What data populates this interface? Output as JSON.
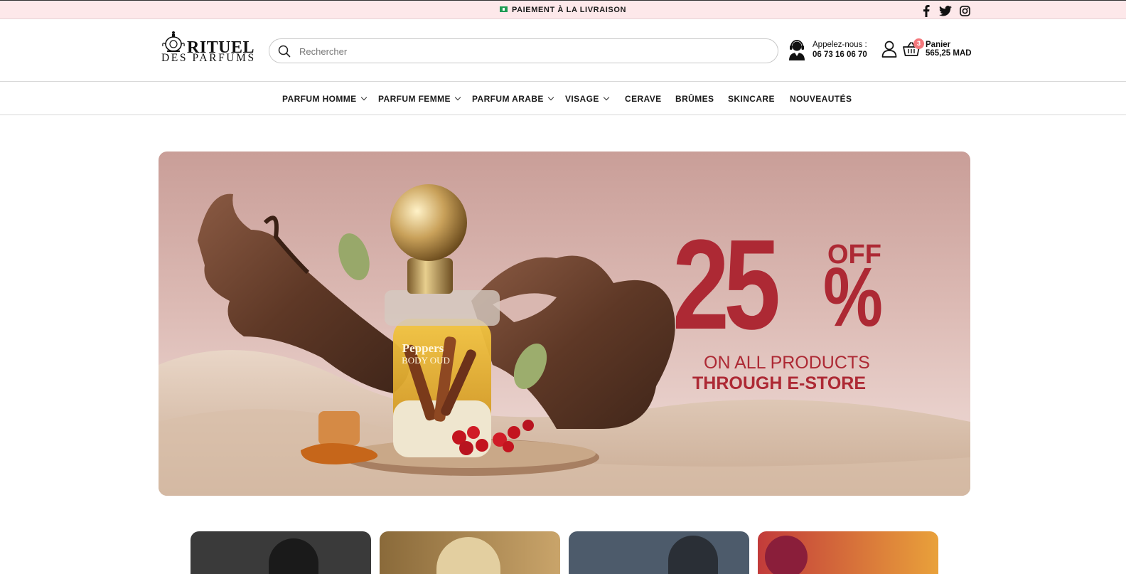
{
  "topbar": {
    "announcement": "PAIEMENT À LA LIVRAISON",
    "social": [
      "facebook-icon",
      "twitter-icon",
      "instagram-icon"
    ]
  },
  "header": {
    "logo_line1": "RITUEL",
    "logo_line2": "DES PARFUMS",
    "search_placeholder": "Rechercher",
    "call_label": "Appelez-nous :",
    "call_number": "06 73 16 06 70",
    "cart_count": "3",
    "cart_label": "Panier",
    "cart_total": "565,25 MAD"
  },
  "nav": {
    "items": [
      {
        "label": "PARFUM HOMME",
        "dropdown": true
      },
      {
        "label": "PARFUM FEMME",
        "dropdown": true
      },
      {
        "label": "PARFUM ARABE",
        "dropdown": true
      },
      {
        "label": "VISAGE",
        "dropdown": true
      },
      {
        "label": "CERAVE",
        "dropdown": false
      },
      {
        "label": "BRÛMES",
        "dropdown": false
      },
      {
        "label": "SKINCARE",
        "dropdown": false
      },
      {
        "label": "NOUVEAUTÉS",
        "dropdown": false
      }
    ]
  },
  "hero": {
    "promo_number": "25",
    "promo_off": "OFF",
    "promo_percent": "%",
    "promo_line1": "ON ALL PRODUCTS",
    "promo_line2": "THROUGH E-STORE",
    "bottle_label1": "Peppers",
    "bottle_label2": "BODY OUD"
  },
  "colors": {
    "topbar_bg": "#fde8ea",
    "promo_red": "#ad2934",
    "badge": "#f4787c"
  }
}
